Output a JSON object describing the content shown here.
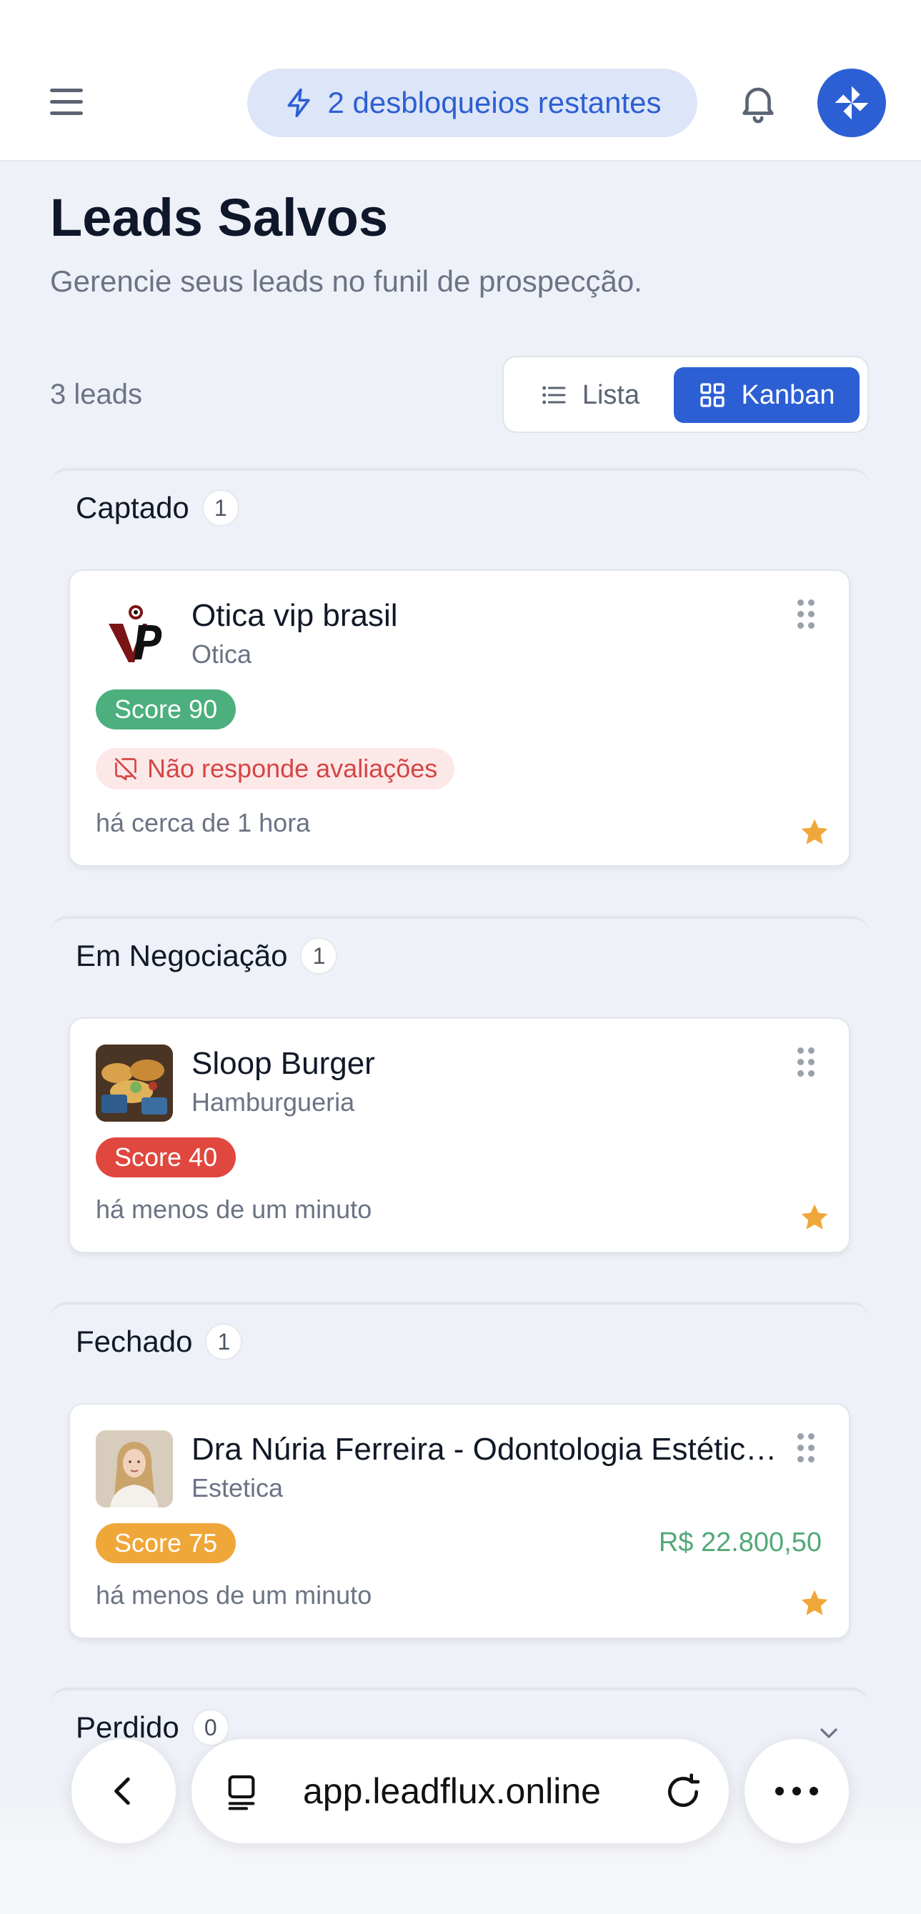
{
  "header": {
    "unlocks_label": "2 desbloqueios restantes"
  },
  "page": {
    "title": "Leads Salvos",
    "subtitle": "Gerencie seus leads no funil de prospecção.",
    "lead_count": "3 leads"
  },
  "view_toggle": {
    "list_label": "Lista",
    "kanban_label": "Kanban",
    "selected": "Kanban"
  },
  "columns": [
    {
      "title": "Captado",
      "count": "1",
      "cards": [
        {
          "name": "Otica vip brasil",
          "category": "Otica",
          "score": "Score 90",
          "score_color": "#4caf7d",
          "tag": "Não responde avaliações",
          "time": "há cerca de 1 hora",
          "starred": true
        }
      ]
    },
    {
      "title": "Em Negociação",
      "count": "1",
      "cards": [
        {
          "name": "Sloop Burger",
          "category": "Hamburgueria",
          "score": "Score 40",
          "score_color": "#e0483f",
          "time": "há menos de um minuto",
          "starred": true
        }
      ]
    },
    {
      "title": "Fechado",
      "count": "1",
      "cards": [
        {
          "name": "Dra Núria Ferreira - Odontologia Estética e Harmonização",
          "category": "Estetica",
          "score": "Score 75",
          "score_color": "#f0a73a",
          "value": "R$ 22.800,50",
          "time": "há menos de um minuto",
          "starred": true
        }
      ]
    },
    {
      "title": "Perdido",
      "count": "0",
      "cards": []
    }
  ],
  "browser": {
    "url": "app.leadflux.online"
  },
  "colors": {
    "accent": "#2d5fd4",
    "star": "#f0a73a",
    "value": "#52a878"
  }
}
